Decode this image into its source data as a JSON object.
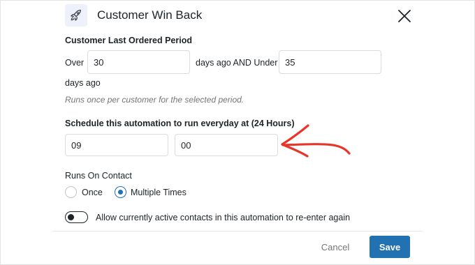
{
  "modal": {
    "title": "Customer Win Back",
    "icon": "rocket-icon"
  },
  "period": {
    "label": "Customer Last Ordered Period",
    "over_label": "Over",
    "over_value": "30",
    "middle_label": "days ago AND Under",
    "under_value": "35",
    "suffix_label": "days ago",
    "help": "Runs once per customer for the selected period."
  },
  "schedule": {
    "label": "Schedule this automation to run everyday at (24 Hours)",
    "hour": "09",
    "minute": "00"
  },
  "runs_on_contact": {
    "label": "Runs On Contact",
    "options": [
      {
        "label": "Once",
        "checked": false
      },
      {
        "label": "Multiple Times",
        "checked": true
      }
    ]
  },
  "reenter": {
    "label": "Allow currently active contacts in this automation to re-enter again",
    "enabled": false
  },
  "footer": {
    "cancel_label": "Cancel",
    "save_label": "Save"
  },
  "colors": {
    "accent": "#2271b1",
    "annotation_arrow": "#e8352a",
    "icon_bg": "#eef0fb"
  }
}
